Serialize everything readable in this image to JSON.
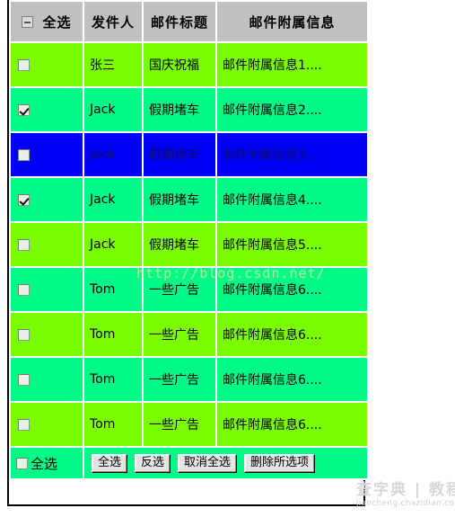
{
  "table": {
    "columns": [
      {
        "key": "check",
        "label": "全选"
      },
      {
        "key": "sender",
        "label": "发件人"
      },
      {
        "key": "title",
        "label": "邮件标题"
      },
      {
        "key": "info",
        "label": "邮件附属信息"
      }
    ],
    "header_checkbox_state": "indeterminate",
    "rows": [
      {
        "checked": false,
        "sender": "张三",
        "title": "国庆祝福",
        "info": "邮件附属信息1....",
        "style": "lime"
      },
      {
        "checked": true,
        "sender": "Jack",
        "title": "假期堵车",
        "info": "邮件附属信息2....",
        "style": "spring"
      },
      {
        "checked": false,
        "sender": "Jack",
        "title": "假期堵车",
        "info": "邮件附属信息3....",
        "style": "blue"
      },
      {
        "checked": true,
        "sender": "Jack",
        "title": "假期堵车",
        "info": "邮件附属信息4....",
        "style": "spring"
      },
      {
        "checked": false,
        "sender": "Jack",
        "title": "假期堵车",
        "info": "邮件附属信息5....",
        "style": "lime"
      },
      {
        "checked": false,
        "sender": "Tom",
        "title": "一些广告",
        "info": "邮件附属信息6....",
        "style": "spring"
      },
      {
        "checked": false,
        "sender": "Tom",
        "title": "一些广告",
        "info": "邮件附属信息6....",
        "style": "lime"
      },
      {
        "checked": false,
        "sender": "Tom",
        "title": "一些广告",
        "info": "邮件附属信息6....",
        "style": "spring"
      },
      {
        "checked": false,
        "sender": "Tom",
        "title": "一些广告",
        "info": "邮件附属信息6....",
        "style": "lime"
      }
    ]
  },
  "footer": {
    "select_all_checkbox_checked": false,
    "select_all_label": "全选",
    "buttons": [
      {
        "name": "select-all-button",
        "label": "全选"
      },
      {
        "name": "invert-select-button",
        "label": "反选"
      },
      {
        "name": "deselect-all-button",
        "label": "取消全选"
      },
      {
        "name": "delete-selected-button",
        "label": "删除所选项"
      }
    ]
  },
  "watermarks": {
    "url": "http://blog.csdn.net/",
    "brand_main": "查字典 | 教程网",
    "brand_sub": "jiaocheng.chazidian.com"
  },
  "colors": {
    "header_bg": "#c0c0c0",
    "row_lime": "#7cfc00",
    "row_spring": "#00fa88",
    "row_selected": "#0000f5",
    "footer_bg": "#00fa88",
    "border": "#000000"
  }
}
